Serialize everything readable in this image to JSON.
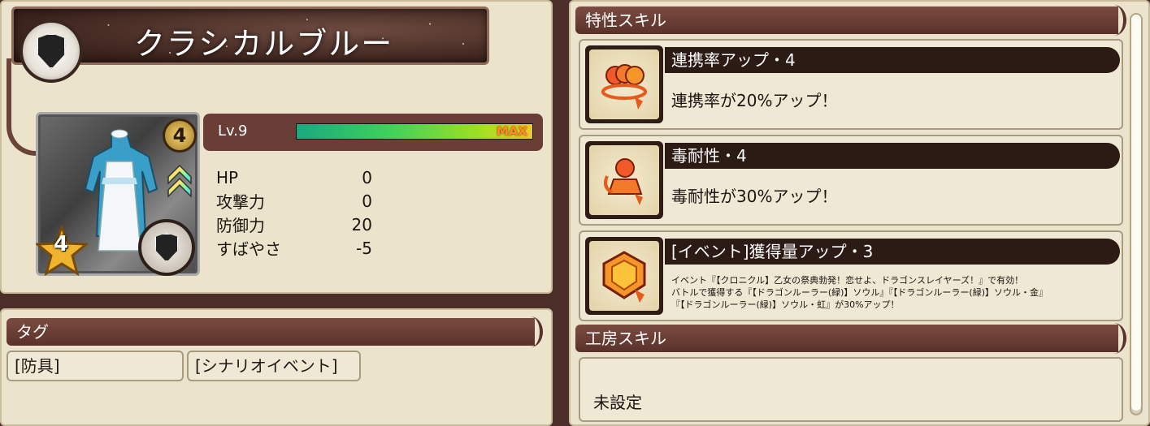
{
  "item": {
    "name": "クラシカルブルー",
    "card_level": "4",
    "rarity": "4"
  },
  "level": {
    "label": "Lv.9",
    "progress": 1.0,
    "max_label": "MAX"
  },
  "stats": [
    {
      "label": "HP",
      "value": "0"
    },
    {
      "label": "攻撃力",
      "value": "0"
    },
    {
      "label": "防御力",
      "value": "20"
    },
    {
      "label": "すばやさ",
      "value": "-5"
    }
  ],
  "tags": {
    "header": "タグ",
    "items": [
      "[防具]",
      "[シナリオイベント]"
    ]
  },
  "trait_skills": {
    "header": "特性スキル",
    "items": [
      {
        "name": "連携率アップ・4",
        "desc": "連携率が20%アップ！",
        "icon": "link-rate-icon"
      },
      {
        "name": "毒耐性・4",
        "desc": "毒耐性が30%アップ！",
        "icon": "poison-resist-icon"
      },
      {
        "name": "[イベント]獲得量アップ・3",
        "desc_lines": [
          "イベント『【クロニクル】乙女の祭典勃発！恋せよ、ドラゴンスレイヤーズ！』で有効！",
          "バトルで獲得する『【ドラゴンルーラー(緑)】ソウル』『【ドラゴンルーラー(緑)】ソウル・金』",
          "『【ドラゴンルーラー(緑)】ソウル・虹』が30%アップ！"
        ],
        "icon": "gem-icon"
      }
    ]
  },
  "workshop": {
    "header": "工房スキル",
    "value": "未設定"
  },
  "colors": {
    "panel": "#ebe3cc",
    "header": "#5a322a",
    "exp_bar": "#3fd25b",
    "max_label": "#ff8a2a"
  }
}
